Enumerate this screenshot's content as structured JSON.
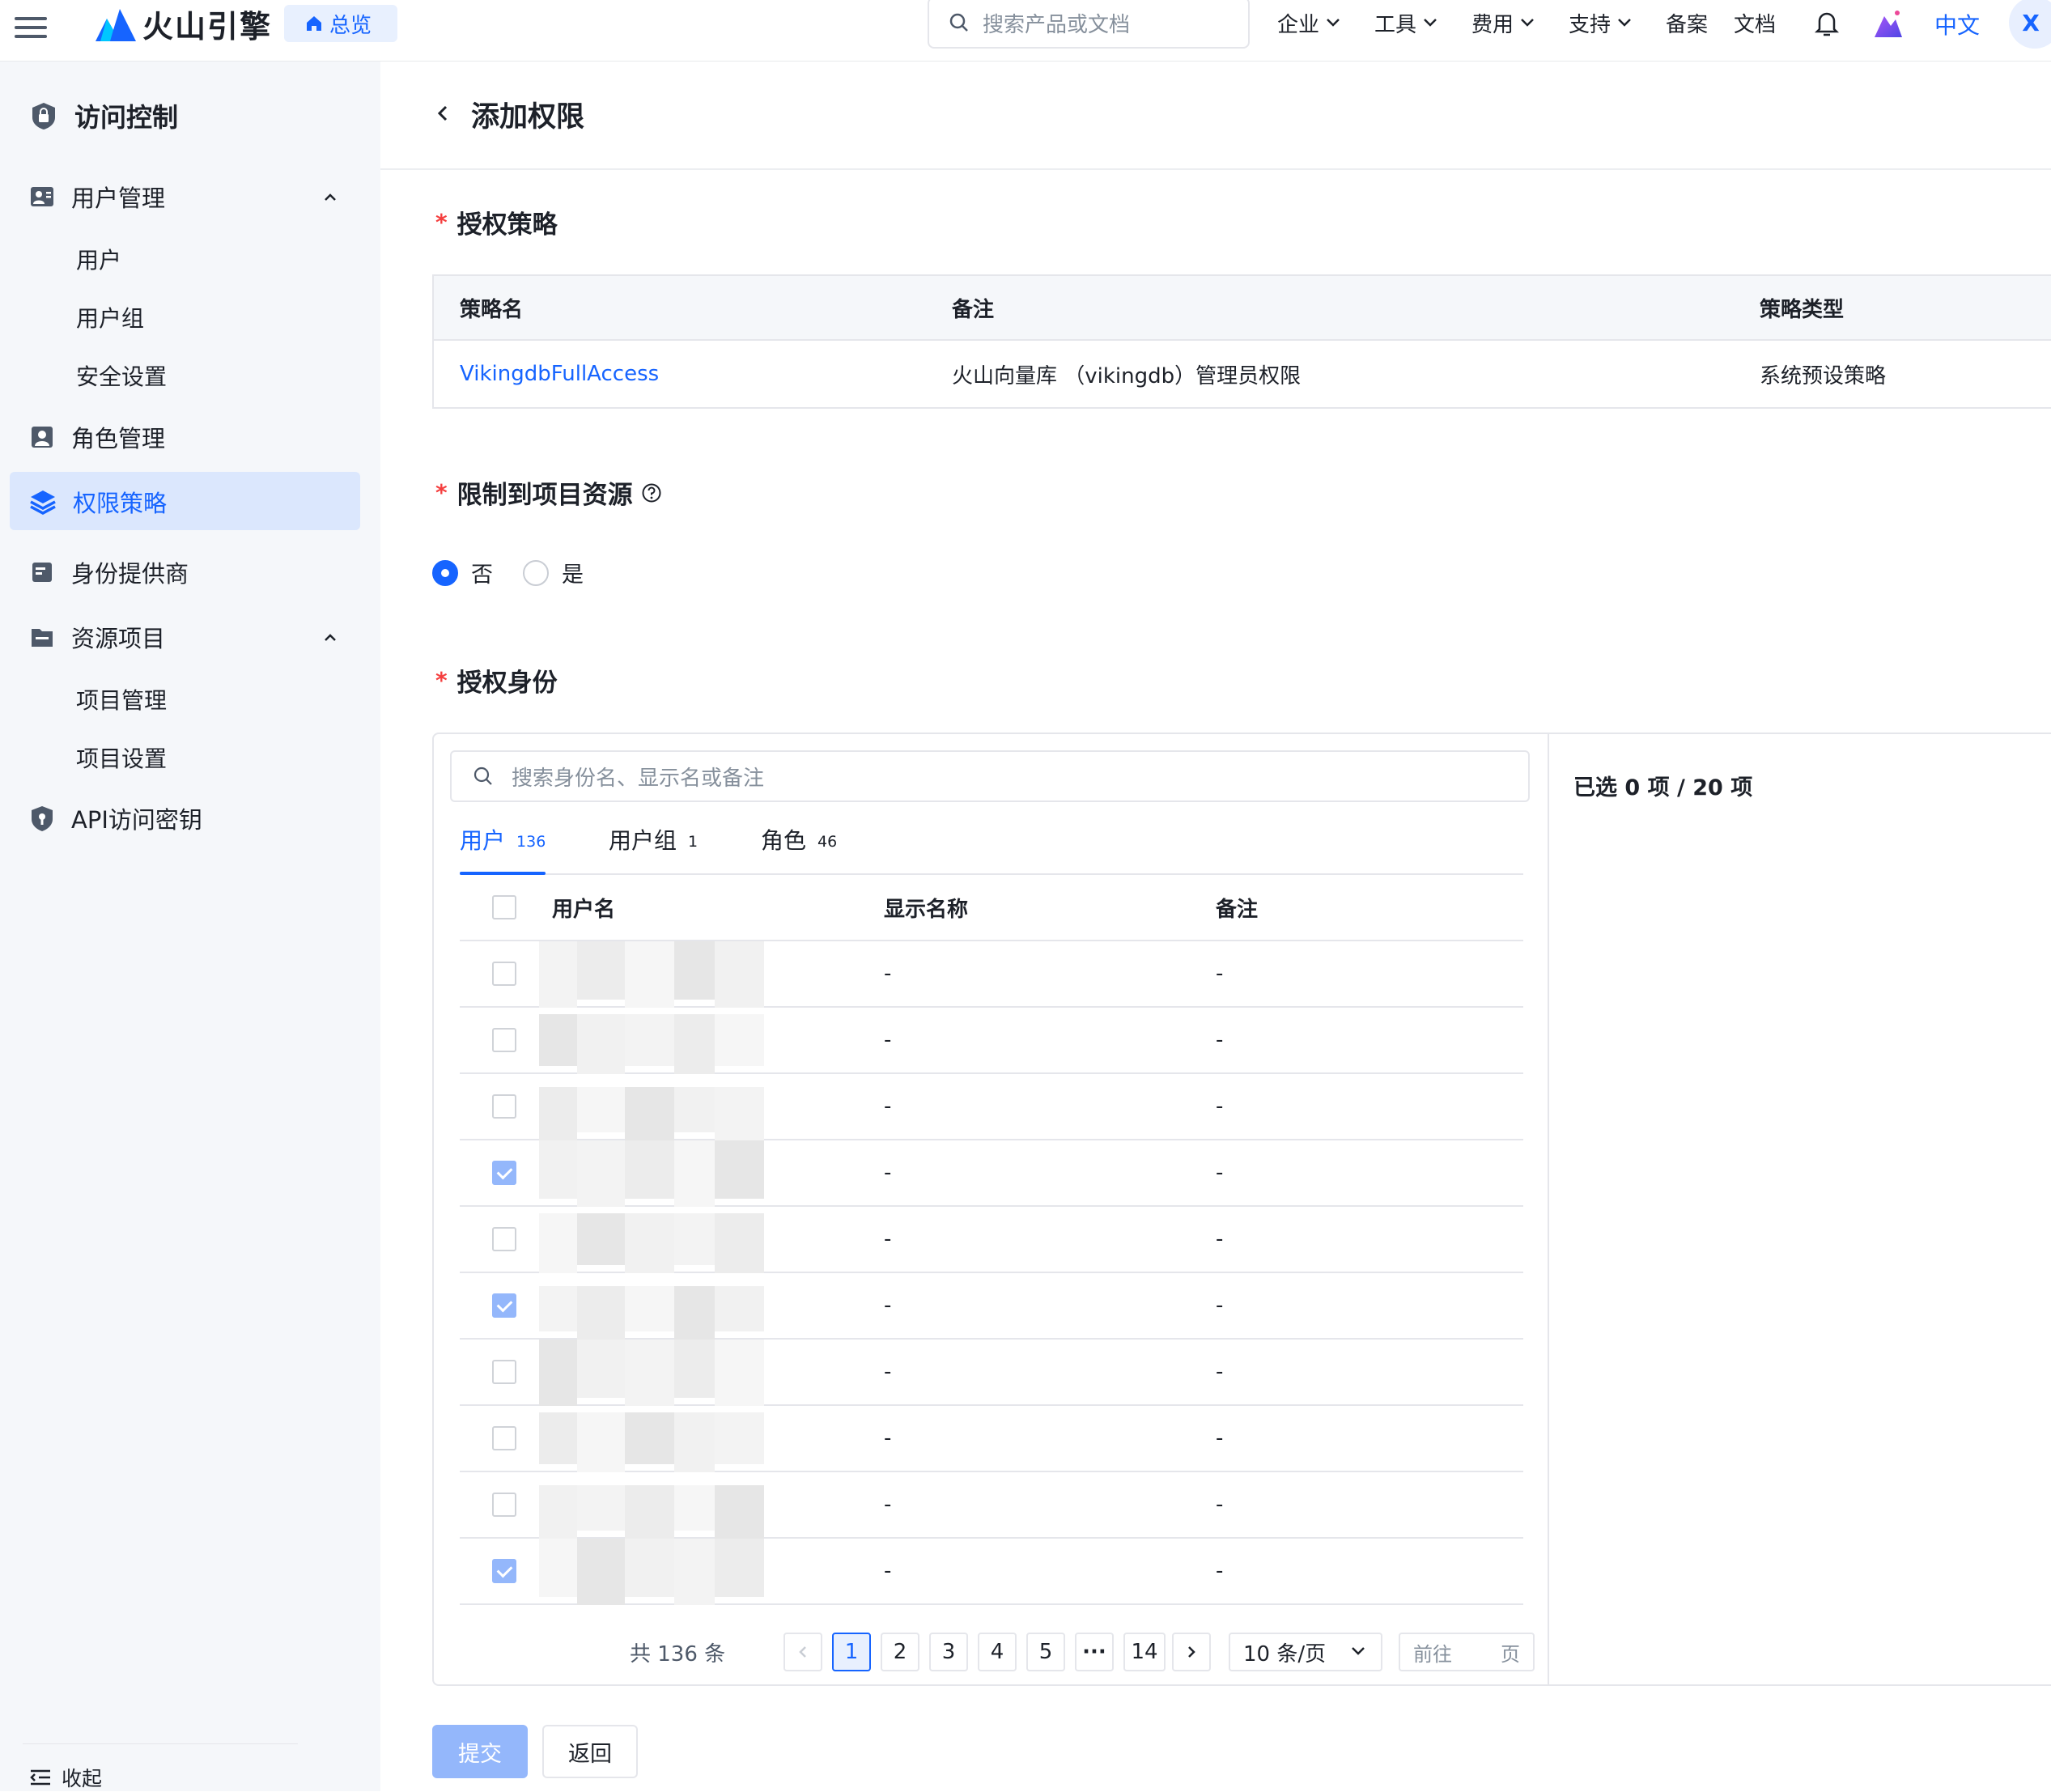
{
  "topbar": {
    "brand": "火山引擎",
    "home_label": "总览",
    "search_placeholder": "搜索产品或文档",
    "nav": [
      {
        "label": "企业",
        "has_chevron": true
      },
      {
        "label": "工具",
        "has_chevron": true
      },
      {
        "label": "费用",
        "has_chevron": true
      },
      {
        "label": "支持",
        "has_chevron": true
      },
      {
        "label": "备案",
        "has_chevron": false
      },
      {
        "label": "文档",
        "has_chevron": false
      }
    ],
    "language": "中文",
    "avatar_initial": "X"
  },
  "sidebar": {
    "title": "访问控制",
    "user_mgmt": "用户管理",
    "users": "用户",
    "user_groups": "用户组",
    "security": "安全设置",
    "role_mgmt": "角色管理",
    "policies": "权限策略",
    "idp": "身份提供商",
    "resources": "资源项目",
    "project_mgmt": "项目管理",
    "project_settings": "项目设置",
    "api_keys": "API访问密钥",
    "collapse": "收起"
  },
  "page": {
    "title": "添加权限",
    "policy_section": "授权策略",
    "policy_table": {
      "headers": [
        "策略名",
        "备注",
        "策略类型"
      ],
      "row": {
        "name": "VikingdbFullAccess",
        "remark": "火山向量库 （vikingdb）管理员权限",
        "type": "系统预设策略"
      }
    },
    "restrict_section": "限制到项目资源",
    "radio_no": "否",
    "radio_yes": "是",
    "radio_selected": "否",
    "identity_section": "授权身份",
    "identity_search_placeholder": "搜索身份名、显示名或备注",
    "tabs": [
      {
        "label": "用户",
        "count": "136",
        "active": true
      },
      {
        "label": "用户组",
        "count": "1",
        "active": false
      },
      {
        "label": "角色",
        "count": "46",
        "active": false
      }
    ],
    "user_table": {
      "headers": [
        "用户名",
        "显示名称",
        "备注"
      ],
      "rows": [
        {
          "checked": false,
          "display": "-",
          "remark": "-"
        },
        {
          "checked": false,
          "display": "-",
          "remark": "-"
        },
        {
          "checked": false,
          "display": "-",
          "remark": "-"
        },
        {
          "checked": true,
          "display": "-",
          "remark": "-"
        },
        {
          "checked": false,
          "display": "-",
          "remark": "-"
        },
        {
          "checked": true,
          "display": "-",
          "remark": "-"
        },
        {
          "checked": false,
          "display": "-",
          "remark": "-"
        },
        {
          "checked": false,
          "display": "-",
          "remark": "-"
        },
        {
          "checked": false,
          "display": "-",
          "remark": "-"
        },
        {
          "checked": true,
          "display": "-",
          "remark": "-"
        }
      ]
    },
    "pagination": {
      "total": "共 136 条",
      "pages": [
        "1",
        "2",
        "3",
        "4",
        "5",
        "···",
        "14"
      ],
      "current": "1",
      "page_size": "10 条/页",
      "goto_label": "前往",
      "goto_suffix": "页"
    },
    "selected_info": "已选 0 项 / 20 项",
    "submit": "提交",
    "back": "返回"
  },
  "colors": {
    "primary": "#1664ff",
    "required": "#f53f3f",
    "sidebar_bg": "#f5f7fa",
    "active_bg": "#dbe7fd"
  }
}
